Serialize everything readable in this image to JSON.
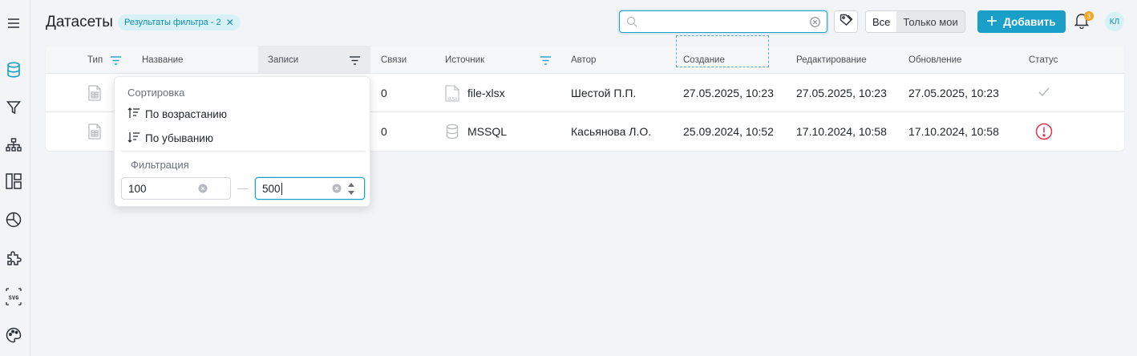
{
  "header": {
    "title": "Датасеты",
    "filter_chip": "Результаты фильтра - 2",
    "search_value": "",
    "seg_all": "Все",
    "seg_mine": "Только мои",
    "add_label": "Добавить",
    "notif_count": "3",
    "avatar_initials": "КЛ"
  },
  "sidebar": {
    "icons": [
      "menu-icon",
      "database-icon",
      "filter-icon",
      "hierarchy-icon",
      "dashboard-icon",
      "pie-chart-icon",
      "puzzle-icon",
      "svg-icon",
      "palette-icon"
    ],
    "svg_label": "SVG"
  },
  "table": {
    "columns": [
      "Тип",
      "Название",
      "Записи",
      "Связи",
      "Источник",
      "Автор",
      "Создание",
      "Редактирование",
      "Обновление",
      "Статус"
    ],
    "rows": [
      {
        "links": "0",
        "source": "file-xlsx",
        "source_icon": "xlsx-file-icon",
        "author": "Шестой П.П.",
        "created": "27.05.2025, 10:23",
        "edited": "27.05.2025, 10:23",
        "updated": "27.05.2025, 10:23",
        "status": "ok"
      },
      {
        "links": "0",
        "source": "MSSQL",
        "source_icon": "database-icon",
        "author": "Касьянова Л.О.",
        "created": "25.09.2024, 10:52",
        "edited": "17.10.2024, 10:58",
        "updated": "17.10.2024, 10:58",
        "status": "error"
      }
    ],
    "xlsx_label": "XLSX"
  },
  "dropdown": {
    "sort_title": "Сортировка",
    "asc": "По возрастанию",
    "desc": "По убыванию",
    "filter_title": "Фильтрация",
    "from": "100",
    "to": "500"
  },
  "colors": {
    "accent": "#1aa0c8",
    "error": "#e0334a",
    "badge": "#f5a623"
  }
}
